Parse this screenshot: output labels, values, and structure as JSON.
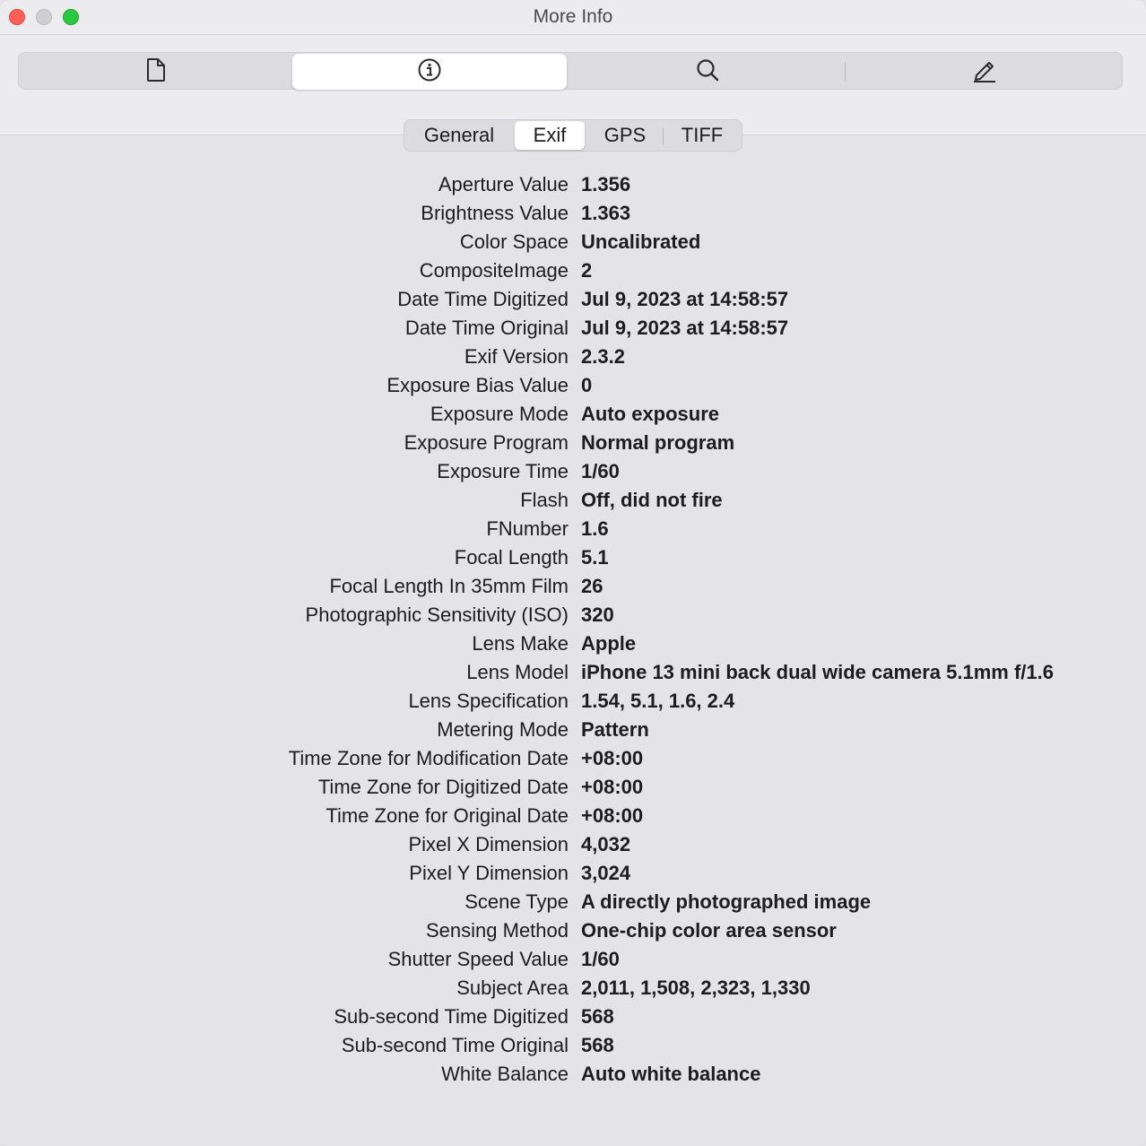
{
  "window": {
    "title": "More Info"
  },
  "toolbar": {
    "tabs": [
      {
        "name": "document",
        "icon": "document-icon"
      },
      {
        "name": "info",
        "icon": "info-icon",
        "active": true
      },
      {
        "name": "search",
        "icon": "search-icon"
      },
      {
        "name": "edit",
        "icon": "pencil-icon"
      }
    ]
  },
  "subtabs": {
    "general": "General",
    "exif": "Exif",
    "gps": "GPS",
    "tiff": "TIFF",
    "active": "Exif"
  },
  "exif_rows": [
    {
      "label": "Aperture Value",
      "value": "1.356"
    },
    {
      "label": "Brightness Value",
      "value": "1.363"
    },
    {
      "label": "Color Space",
      "value": "Uncalibrated"
    },
    {
      "label": "CompositeImage",
      "value": "2"
    },
    {
      "label": "Date Time Digitized",
      "value": "Jul 9, 2023 at 14:58:57"
    },
    {
      "label": "Date Time Original",
      "value": "Jul 9, 2023 at 14:58:57"
    },
    {
      "label": "Exif Version",
      "value": "2.3.2"
    },
    {
      "label": "Exposure Bias Value",
      "value": "0"
    },
    {
      "label": "Exposure Mode",
      "value": "Auto exposure"
    },
    {
      "label": "Exposure Program",
      "value": "Normal program"
    },
    {
      "label": "Exposure Time",
      "value": "1/60"
    },
    {
      "label": "Flash",
      "value": "Off, did not fire"
    },
    {
      "label": "FNumber",
      "value": "1.6"
    },
    {
      "label": "Focal Length",
      "value": "5.1"
    },
    {
      "label": "Focal Length In 35mm Film",
      "value": "26"
    },
    {
      "label": "Photographic Sensitivity (ISO)",
      "value": "320"
    },
    {
      "label": "Lens Make",
      "value": "Apple"
    },
    {
      "label": "Lens Model",
      "value": "iPhone 13 mini back dual wide camera 5.1mm f/1.6"
    },
    {
      "label": "Lens Specification",
      "value": "1.54, 5.1, 1.6, 2.4"
    },
    {
      "label": "Metering Mode",
      "value": "Pattern"
    },
    {
      "label": "Time Zone for Modification Date",
      "value": "+08:00"
    },
    {
      "label": "Time Zone for Digitized Date",
      "value": "+08:00"
    },
    {
      "label": "Time Zone for Original Date",
      "value": "+08:00"
    },
    {
      "label": "Pixel X Dimension",
      "value": "4,032"
    },
    {
      "label": "Pixel Y Dimension",
      "value": "3,024"
    },
    {
      "label": "Scene Type",
      "value": "A directly photographed image"
    },
    {
      "label": "Sensing Method",
      "value": "One-chip color area sensor"
    },
    {
      "label": "Shutter Speed Value",
      "value": "1/60"
    },
    {
      "label": "Subject Area",
      "value": "2,011, 1,508, 2,323, 1,330"
    },
    {
      "label": "Sub-second Time Digitized",
      "value": "568"
    },
    {
      "label": "Sub-second Time Original",
      "value": "568"
    },
    {
      "label": "White Balance",
      "value": "Auto white balance"
    }
  ]
}
